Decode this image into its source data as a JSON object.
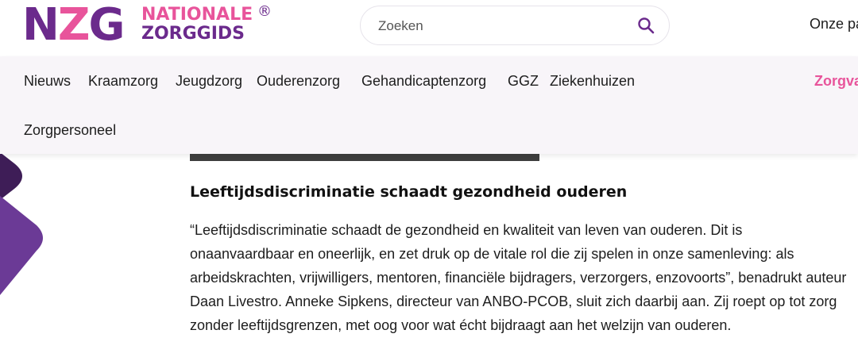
{
  "brand": {
    "abbr_n": "N",
    "abbr_z": "Z",
    "abbr_g": "G",
    "line1": "NATIONALE",
    "line2": "ZORGGIDS",
    "registered": "®"
  },
  "search": {
    "placeholder": "Zoeken"
  },
  "header": {
    "right_link": "Onze pa"
  },
  "nav": {
    "items": [
      "Nieuws",
      "Kraamzorg",
      "Jeugdzorg",
      "Ouderenzorg",
      "Gehandicaptenzorg",
      "GGZ",
      "Ziekenhuizen",
      "Zorgpersoneel"
    ],
    "accent_item": "Zorgva"
  },
  "article": {
    "heading": "Leeftijdsdiscriminatie schaadt gezondheid ouderen",
    "paragraph": "“Leeftijdsdiscriminatie schaadt de gezondheid en kwaliteit van leven van ouderen. Dit is onaanvaardbaar en oneerlijk, en zet druk op de vitale rol die zij spelen in onze samenleving: als arbeidskrachten, vrijwilligers, mentoren, financiële bijdragers, verzorgers, enzovoorts”, benadrukt auteur Daan Livestro. Anneke Sipkens, directeur van ANBO-PCOB, sluit zich daarbij aan. Zij roept op tot zorg zonder leeftijdsgrenzen, met oog voor wat écht bijdraagt aan het welzijn van ouderen."
  },
  "colors": {
    "brand_purple": "#6b2a8c",
    "brand_pink": "#e8549b",
    "nav_background": "#f8f5f9"
  },
  "icons": {
    "search": "search-icon"
  }
}
